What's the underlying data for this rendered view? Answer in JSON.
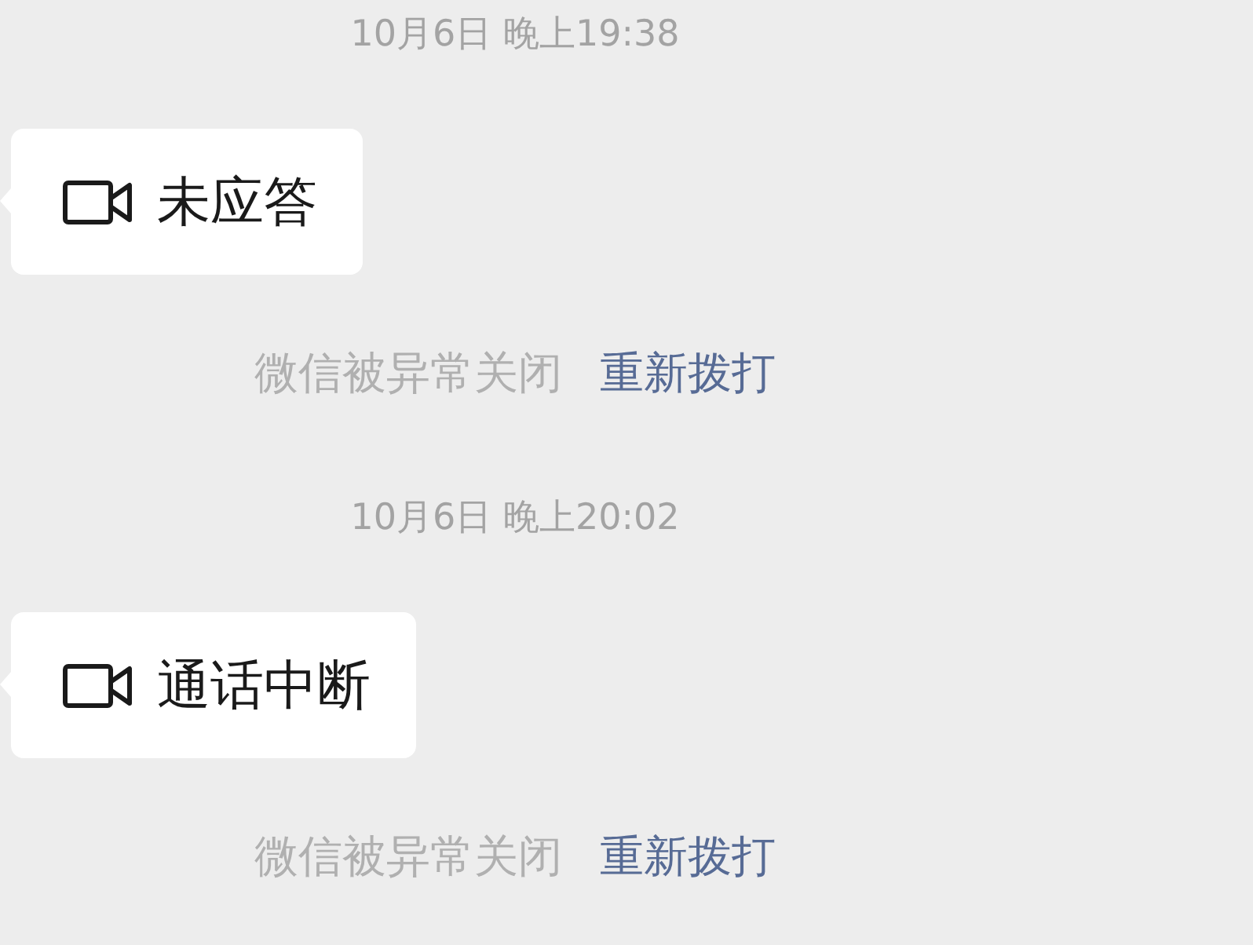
{
  "messages": [
    {
      "kind": "timestamp",
      "text": "10月6日 晚上19:38"
    },
    {
      "kind": "call",
      "text": "未应答"
    },
    {
      "kind": "system",
      "text": "微信被异常关闭",
      "link": "重新拨打"
    },
    {
      "kind": "timestamp",
      "text": "10月6日 晚上20:02"
    },
    {
      "kind": "call",
      "text": "通话中断"
    },
    {
      "kind": "system",
      "text": "微信被异常关闭",
      "link": "重新拨打"
    }
  ]
}
